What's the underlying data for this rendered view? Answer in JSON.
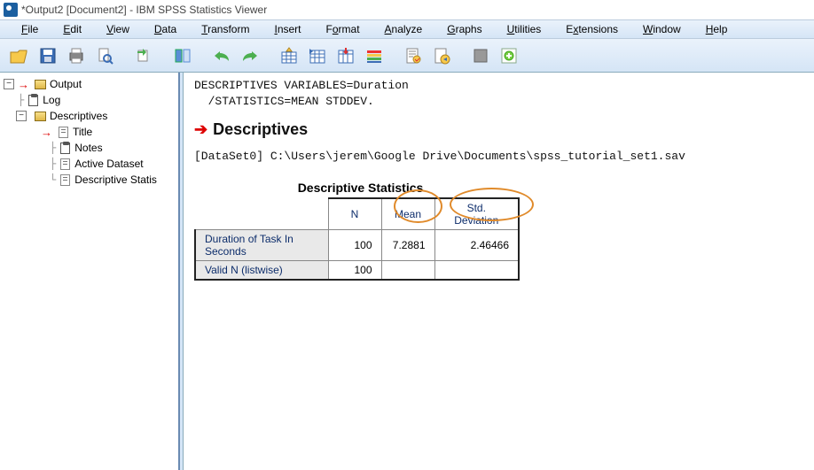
{
  "window": {
    "title": "*Output2 [Document2] - IBM SPSS Statistics Viewer"
  },
  "menu": {
    "file": "File",
    "edit": "Edit",
    "view": "View",
    "data": "Data",
    "transform": "Transform",
    "insert": "Insert",
    "format": "Format",
    "analyze": "Analyze",
    "graphs": "Graphs",
    "utilities": "Utilities",
    "extensions": "Extensions",
    "window": "Window",
    "help": "Help"
  },
  "tree": {
    "root": "Output",
    "log": "Log",
    "descr": "Descriptives",
    "title": "Title",
    "notes": "Notes",
    "activedataset": "Active Dataset",
    "descstat": "Descriptive Statis"
  },
  "syntax": {
    "line1": "DESCRIPTIVES VARIABLES=Duration",
    "line2": "  /STATISTICS=MEAN STDDEV."
  },
  "section": {
    "title": "Descriptives"
  },
  "dataset": {
    "line": "[DataSet0] C:\\Users\\jerem\\Google Drive\\Documents\\spss_tutorial_set1.sav"
  },
  "stats": {
    "title": "Descriptive Statistics",
    "cols": {
      "n": "N",
      "mean": "Mean",
      "std": "Std. Deviation"
    },
    "row1": {
      "label": "Duration of Task In Seconds",
      "n": "100",
      "mean": "7.2881",
      "std": "2.46466"
    },
    "row2": {
      "label": "Valid N (listwise)",
      "n": "100"
    }
  },
  "chart_data": {
    "type": "table",
    "title": "Descriptive Statistics",
    "columns": [
      "",
      "N",
      "Mean",
      "Std. Deviation"
    ],
    "rows": [
      [
        "Duration of Task In Seconds",
        100,
        7.2881,
        2.46466
      ],
      [
        "Valid N (listwise)",
        100,
        null,
        null
      ]
    ]
  }
}
